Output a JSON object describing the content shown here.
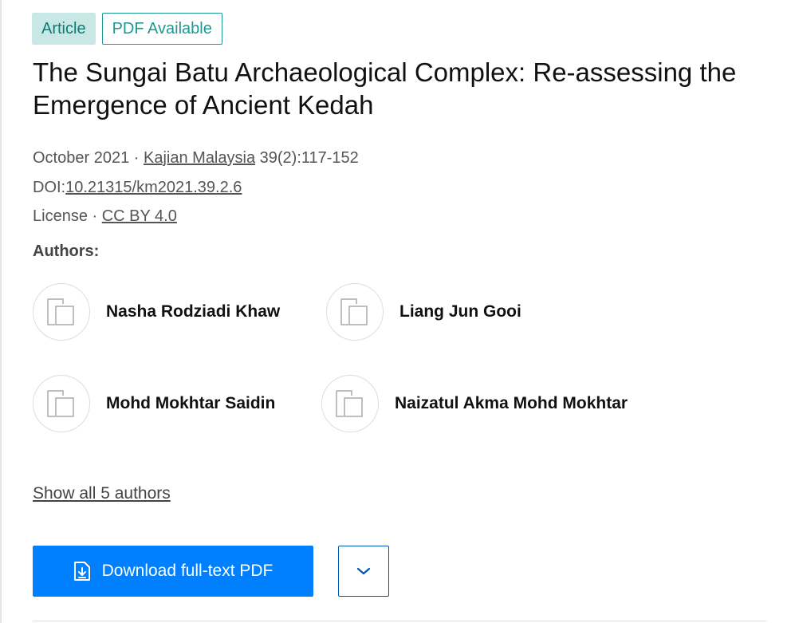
{
  "badges": {
    "type": "Article",
    "availability": "PDF Available"
  },
  "title": "The Sungai Batu Archaeological Complex: Re-assessing the Emergence of Ancient Kedah",
  "meta": {
    "date": "October 2021",
    "separator": "·",
    "journal": "Kajian Malaysia",
    "pages": "39(2):117-152",
    "doi_label": "DOI:",
    "doi": "10.21315/km2021.39.2.6",
    "license_label": "License",
    "license": "CC BY 4.0"
  },
  "authors": {
    "heading": "Authors:",
    "list": [
      {
        "name": "Nasha Rodziadi Khaw",
        "icon": "avatar-placeholder-icon"
      },
      {
        "name": "Liang Jun Gooi",
        "icon": "avatar-placeholder-icon"
      },
      {
        "name": "Mohd Mokhtar Saidin",
        "icon": "avatar-placeholder-icon"
      },
      {
        "name": "Naizatul Akma Mohd Mokhtar",
        "icon": "avatar-placeholder-icon"
      }
    ],
    "show_all": "Show all 5 authors"
  },
  "actions": {
    "download_label": "Download full-text PDF",
    "download_icon": "file-download-icon",
    "dropdown_icon": "chevron-down-icon"
  },
  "colors": {
    "primary": "#0080ff",
    "badge_bg": "#c7e8e4",
    "badge_text": "#0f7a73",
    "teal": "#1a9a90"
  }
}
